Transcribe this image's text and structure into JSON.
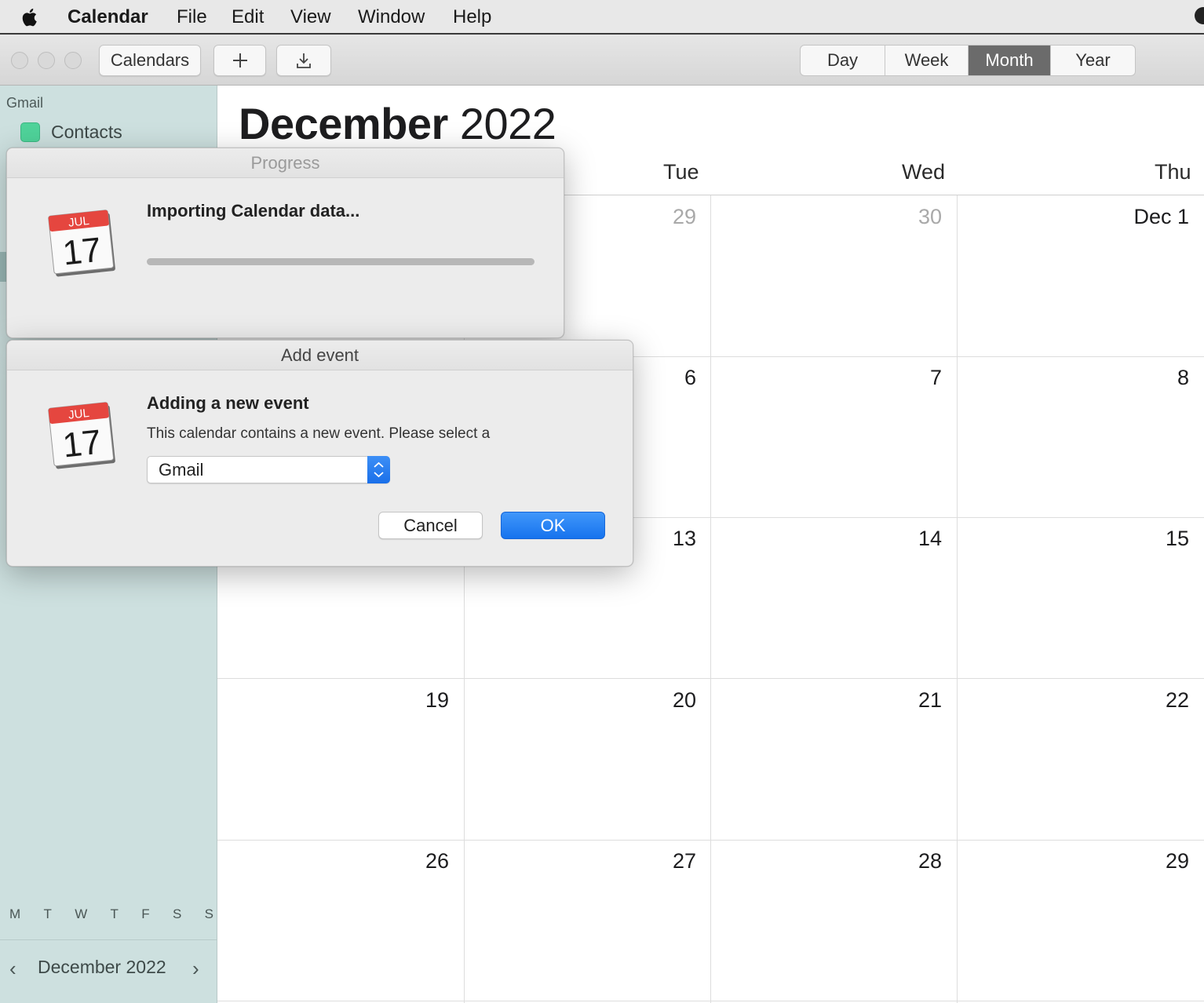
{
  "menubar": {
    "app_name": "Calendar",
    "items": [
      "File",
      "Edit",
      "View",
      "Window",
      "Help"
    ]
  },
  "toolbar": {
    "calendars_label": "Calendars",
    "add_icon": "plus-icon",
    "import_icon": "download-icon",
    "views": [
      "Day",
      "Week",
      "Month",
      "Year"
    ],
    "active_view": "Month"
  },
  "sidebar": {
    "group_label": "Gmail",
    "calendar_item": "Contacts",
    "calendar_color": "#4fd39a",
    "mini_calendar": {
      "title": "December 2022",
      "prev": "‹",
      "next": "›",
      "weekdays": [
        "M",
        "T",
        "W",
        "T",
        "F",
        "S",
        "S"
      ]
    }
  },
  "main": {
    "month": "December",
    "year": "2022",
    "weekdays": [
      "Tue",
      "Wed",
      "Thu"
    ],
    "rows": [
      [
        "29",
        "30",
        "Dec 1"
      ],
      [
        "6",
        "7",
        "8"
      ],
      [
        "13",
        "14",
        "15"
      ],
      [
        "19",
        "20",
        "21",
        "22"
      ],
      [
        "26",
        "27",
        "28",
        "29"
      ]
    ]
  },
  "progress_dialog": {
    "title": "Progress",
    "icon_month": "JUL",
    "icon_day": "17",
    "message": "Importing Calendar data...",
    "progress": 0.0
  },
  "add_event_dialog": {
    "title": "Add event",
    "icon_month": "JUL",
    "icon_day": "17",
    "heading": "Adding a new event",
    "body": "This calendar contains a new event. Please select a",
    "selected_calendar": "Gmail",
    "cancel_label": "Cancel",
    "ok_label": "OK",
    "accent_color": "#1a73ec"
  }
}
